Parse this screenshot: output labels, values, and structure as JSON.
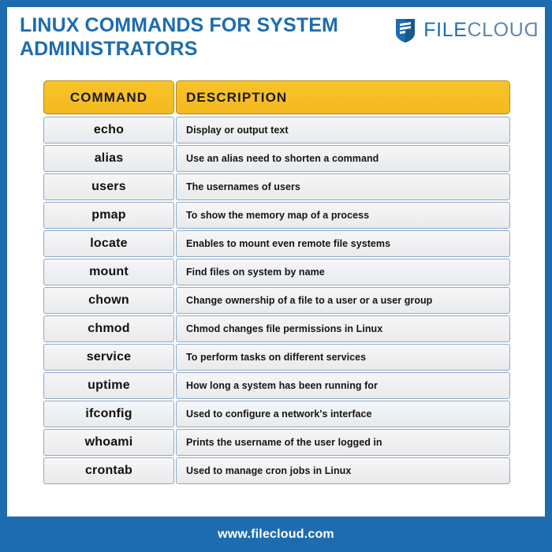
{
  "header": {
    "title": "LINUX COMMANDS FOR SYSTEM ADMINISTRATORS",
    "brand": {
      "icon": "filecloud-shield-logo",
      "word_primary": "FILE",
      "word_secondary": "CLOU",
      "word_tail": "D"
    }
  },
  "colors": {
    "frame_blue": "#1d6cb0",
    "header_yellow": "#f4b91f",
    "row_gray": "#eeeeef",
    "row_border": "#8fa9c4",
    "title_blue": "#1d6cb0",
    "brand_light": "#5f87ad"
  },
  "table": {
    "columns": [
      "COMMAND",
      "DESCRIPTION"
    ],
    "rows": [
      {
        "command": "echo",
        "description": "Display or output text"
      },
      {
        "command": "alias",
        "description": "Use an alias need to shorten a command"
      },
      {
        "command": "users",
        "description": "The usernames of users"
      },
      {
        "command": "pmap",
        "description": "To show the memory map of a process"
      },
      {
        "command": "locate",
        "description": "Enables to mount even remote file systems"
      },
      {
        "command": "mount",
        "description": "Find files on system by name"
      },
      {
        "command": "chown",
        "description": "Change ownership of a file to a user or a user group"
      },
      {
        "command": "chmod",
        "description": "Chmod changes file permissions in Linux"
      },
      {
        "command": "service",
        "description": "To perform tasks on different services"
      },
      {
        "command": "uptime",
        "description": "How long a system has been running for"
      },
      {
        "command": "ifconfig",
        "description": "Used to configure a network's interface"
      },
      {
        "command": "whoami",
        "description": "Prints the username of the user logged in"
      },
      {
        "command": "crontab",
        "description": "Used to manage cron jobs in Linux"
      }
    ]
  },
  "footer": {
    "website": "www.filecloud.com"
  }
}
